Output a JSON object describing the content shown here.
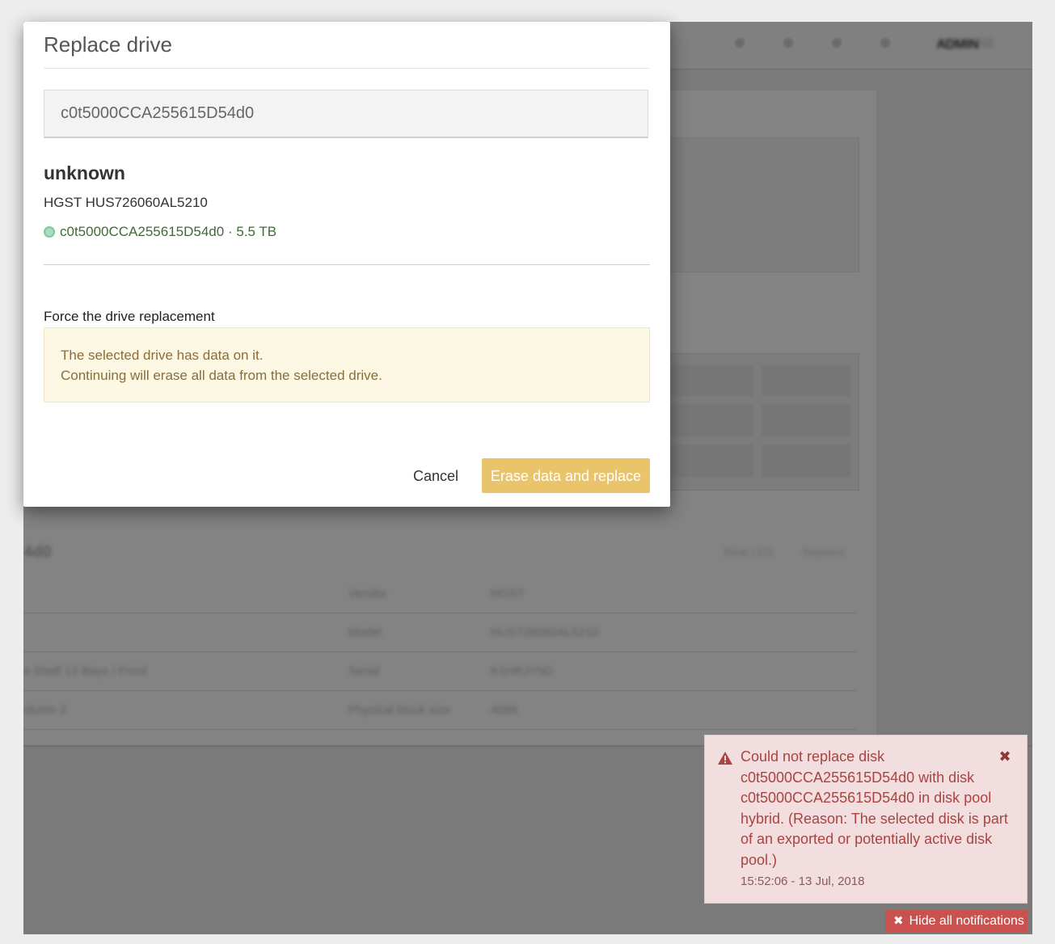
{
  "modal": {
    "title": "Replace drive",
    "selected_drive": "c0t5000CCA255615D54d0",
    "drive_name": "unknown",
    "drive_model": "HGST HUS726060AL5210",
    "drive_id": "c0t5000CCA255615D54d0",
    "drive_size_sep": " · ",
    "drive_size": "5.5 TB",
    "force_label": "Force the drive replacement",
    "warning_line1": "The selected drive has data on it.",
    "warning_line2": "Continuing will erase all data from the selected drive.",
    "cancel_label": "Cancel",
    "erase_label": "Erase data and replace"
  },
  "background": {
    "section_title": "4d0",
    "links": [
      "Blink LED",
      "Replace"
    ],
    "rows": [
      {
        "left": "",
        "key": "Vendor",
        "value": "HGST"
      },
      {
        "left": "",
        "key": "Model",
        "value": "HUS726060AL5210"
      },
      {
        "left": "n Shelf 12 Bays / Front",
        "key": "Serial",
        "value": "K1HRJY5D"
      },
      {
        "left": "olumn 2",
        "key": "Physical block size",
        "value": "4096"
      }
    ],
    "user_label": "ADMIN"
  },
  "notification": {
    "message": "Could not replace disk c0t5000CCA255615D54d0 with disk c0t5000CCA255615D54d0 in disk pool hybrid. (Reason: The selected disk is part of an exported or potentially active disk pool.)",
    "timestamp": "15:52:06 - 13 Jul, 2018",
    "hide_all_label": "Hide all notifications"
  },
  "colors": {
    "accent_yellow": "#e9c46a",
    "status_green": "#3e6b34",
    "error_red": "#a94442",
    "warning_bg": "#fcf8e3"
  },
  "icons": [
    "warning-icon",
    "close-icon",
    "status-dot-icon"
  ]
}
